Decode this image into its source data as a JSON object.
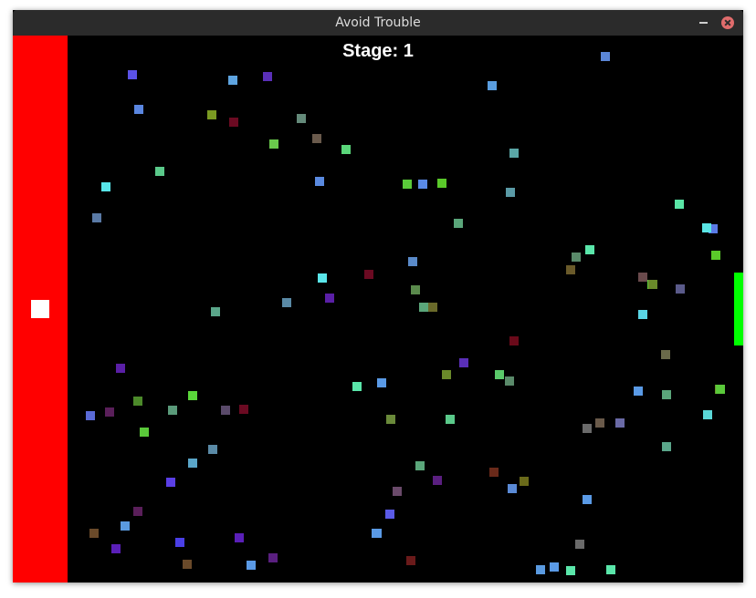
{
  "window": {
    "title": "Avoid Trouble",
    "controls": [
      "minimize-icon",
      "close-icon"
    ]
  },
  "hud": {
    "stage_label": "Stage: 1"
  },
  "colors": {
    "left_zone": "#ff0000",
    "player": "#ffffff",
    "goal": "#00ff00",
    "background": "#000000",
    "titlebar": "#2b2b2b",
    "close_button": "#e06c6c"
  },
  "enemies": [
    {
      "c": "#5b52e6"
    },
    {
      "c": "#5ea4e0"
    },
    {
      "c": "#5a2fb8"
    },
    {
      "c": "#5a86e0"
    },
    {
      "c": "#5b86d6"
    },
    {
      "c": "#7a9a22"
    },
    {
      "c": "#6b0a22"
    },
    {
      "c": "#648a7a"
    },
    {
      "c": "#6a5a4c"
    },
    {
      "c": "#6ac94c"
    },
    {
      "c": "#5ad67a"
    },
    {
      "c": "#5a9ee0"
    },
    {
      "c": "#5ac98a"
    },
    {
      "c": "#58e6ea"
    },
    {
      "c": "#5aa6a6"
    },
    {
      "c": "#5a8ae0"
    },
    {
      "c": "#5ac93a"
    },
    {
      "c": "#5ac92a"
    },
    {
      "c": "#5a9aa6"
    },
    {
      "c": "#5aa67a"
    },
    {
      "c": "#5ae6a6"
    },
    {
      "c": "#5a7aa6"
    },
    {
      "c": "#6b0a22"
    },
    {
      "c": "#5a8ac9"
    },
    {
      "c": "#5ae6ea"
    },
    {
      "c": "#5a1fa6"
    },
    {
      "c": "#5a8aa6"
    },
    {
      "c": "#5aa6a6"
    },
    {
      "c": "#5a8a4c"
    },
    {
      "c": "#5aa67a"
    },
    {
      "c": "#6a6a2a"
    },
    {
      "c": "#5ad6e6"
    },
    {
      "c": "#5a7ae6"
    },
    {
      "c": "#5ae6aa"
    },
    {
      "c": "#5ab6aa"
    },
    {
      "c": "#5ac93a"
    },
    {
      "c": "#5a1fa6"
    },
    {
      "c": "#5a8a6a"
    },
    {
      "c": "#6a4a4c"
    },
    {
      "c": "#5ac93a"
    },
    {
      "c": "#5aa68a"
    },
    {
      "c": "#5a5ac9"
    },
    {
      "c": "#4c8a2a"
    },
    {
      "c": "#5a9a7a"
    },
    {
      "c": "#5a6ad6"
    },
    {
      "c": "#5a1f5a"
    },
    {
      "c": "#6b0a22"
    },
    {
      "c": "#5ad63a"
    },
    {
      "c": "#5ac93a"
    },
    {
      "c": "#5a7ad6"
    },
    {
      "c": "#5a4a6a"
    },
    {
      "c": "#5a8aa6"
    },
    {
      "c": "#5aa6c9"
    },
    {
      "c": "#5a1fa6"
    },
    {
      "c": "#5a3fe6"
    },
    {
      "c": "#5a1f5a"
    },
    {
      "c": "#6a4a2a"
    },
    {
      "c": "#5a9ae0"
    },
    {
      "c": "#5a1fb8"
    },
    {
      "c": "#4a3fe6"
    },
    {
      "c": "#5a1fb8"
    },
    {
      "c": "#6a4a2a"
    },
    {
      "c": "#5a9ae6"
    },
    {
      "c": "#5a1f80"
    },
    {
      "c": "#6a1a1a"
    },
    {
      "c": "#5a9ae6"
    },
    {
      "c": "#5aa67a"
    },
    {
      "c": "#6a4a6a"
    },
    {
      "c": "#5a2fb8"
    },
    {
      "c": "#6a2a1a"
    },
    {
      "c": "#6a6a1a"
    },
    {
      "c": "#5a8ad6"
    },
    {
      "c": "#5a5ae6"
    },
    {
      "c": "#6a4a4a"
    },
    {
      "c": "#5a9ae6"
    },
    {
      "c": "#5a9ae0"
    },
    {
      "c": "#5a6a6a"
    },
    {
      "c": "#5ae6aa"
    },
    {
      "c": "#6a8a2a"
    },
    {
      "c": "#5ae6aa"
    },
    {
      "c": "#5a8ae6"
    },
    {
      "c": "#6a0a1a"
    },
    {
      "c": "#5a9ae6"
    },
    {
      "c": "#6a8a3a"
    },
    {
      "c": "#5ac98a"
    },
    {
      "c": "#5ae6aa"
    },
    {
      "c": "#5ac96a"
    },
    {
      "c": "#6a5a2a"
    },
    {
      "c": "#5ae6e6"
    },
    {
      "c": "#5ac92a"
    },
    {
      "c": "#5aa67a"
    },
    {
      "c": "#6a7a2a"
    },
    {
      "c": "#6a6a4a"
    },
    {
      "c": "#5a5a8a"
    },
    {
      "c": "#5ad6e6"
    },
    {
      "c": "#5a8a6a"
    },
    {
      "c": "#5a9ae6"
    },
    {
      "c": "#6a9a2a"
    },
    {
      "c": "#6a6aa6"
    },
    {
      "c": "#6a6a6a"
    },
    {
      "c": "#6a5a4a"
    },
    {
      "c": "#5ad6d6"
    },
    {
      "c": "#5aa68a"
    },
    {
      "c": "#5a1f80"
    },
    {
      "c": "#6a2a1a"
    },
    {
      "c": "#6a6a1a"
    },
    {
      "c": "#5a9ae6"
    },
    {
      "c": "#5a9ae6"
    },
    {
      "c": "#6a6a6a"
    },
    {
      "c": "#5ae6aa"
    },
    {
      "c": "#6a8a2a"
    },
    {
      "c": "#5ae6aa"
    },
    {
      "c": "#5ac93a"
    }
  ]
}
